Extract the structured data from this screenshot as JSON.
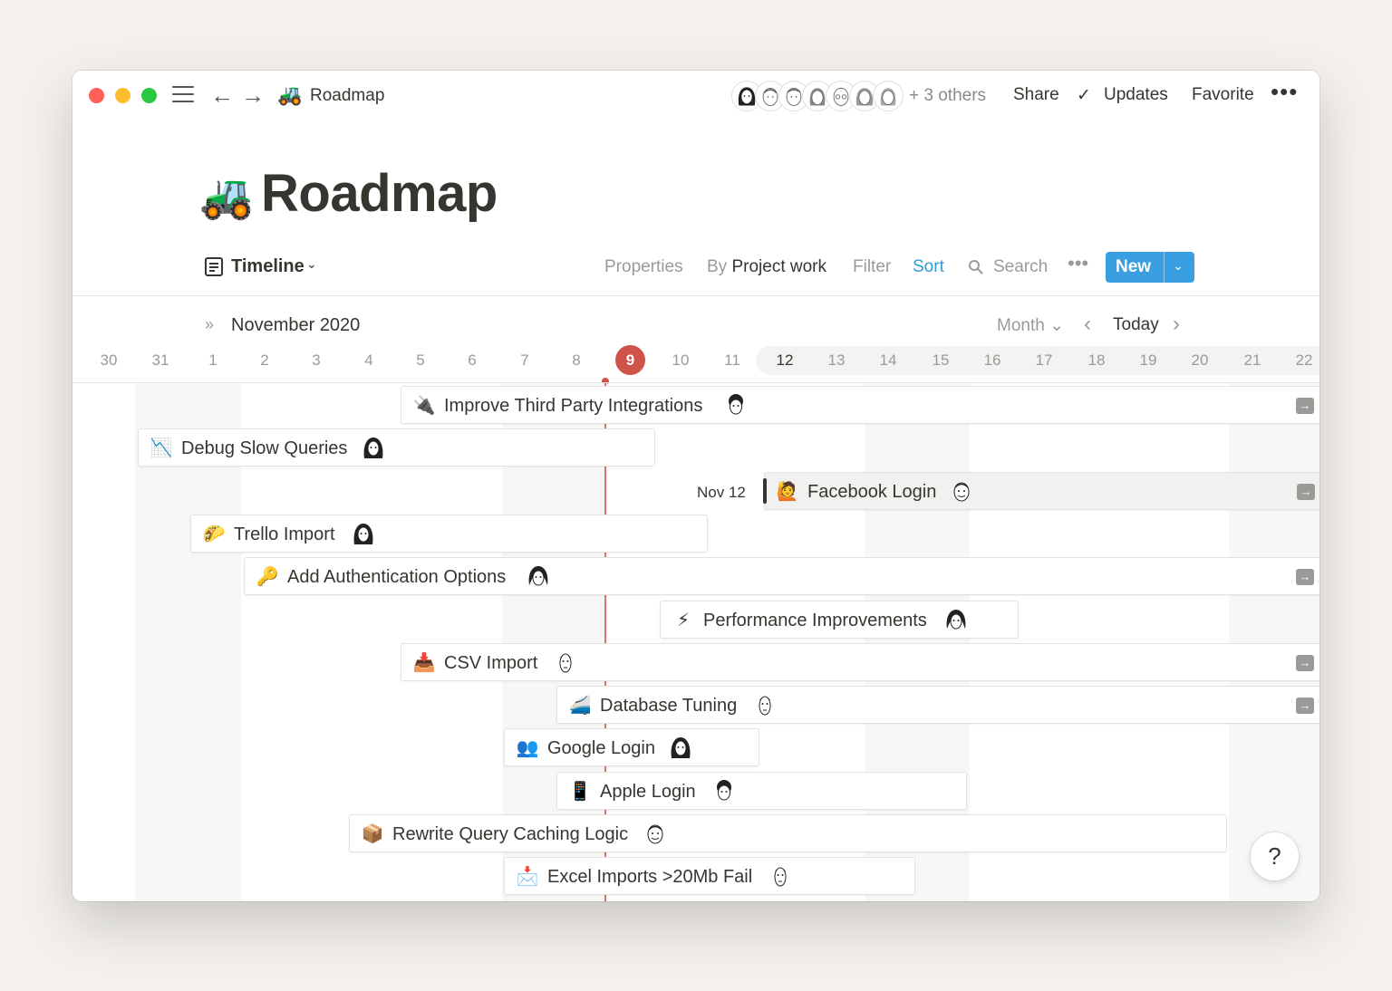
{
  "titlebar": {
    "breadcrumb_icon": "🚜",
    "breadcrumb_title": "Roadmap",
    "others_label": "+ 3 others",
    "share_label": "Share",
    "updates_label": "Updates",
    "favorite_label": "Favorite",
    "more_label": "•••"
  },
  "page": {
    "icon": "🚜",
    "title": "Roadmap"
  },
  "viewbar": {
    "view_name": "Timeline",
    "properties_label": "Properties",
    "by_label": "By",
    "group_label": "Project work",
    "filter_label": "Filter",
    "sort_label": "Sort",
    "search_label": "Search",
    "more_label": "•••",
    "new_label": "New"
  },
  "timeline": {
    "month_label": "November 2020",
    "scale_label": "Month",
    "today_label": "Today",
    "days": [
      "30",
      "31",
      "1",
      "2",
      "3",
      "4",
      "5",
      "6",
      "7",
      "8",
      "9",
      "10",
      "11",
      "12",
      "13",
      "14",
      "15",
      "16",
      "17",
      "18",
      "19",
      "20",
      "21",
      "22"
    ],
    "today_day": "9",
    "selected_date_label": "Nov 12",
    "accent_color": "#d0534a",
    "new_button_color": "#3a9fe0",
    "items": [
      {
        "icon": "🔌",
        "name": "Improve Third Party Integrations",
        "face": "curly-hair-face-icon",
        "extends": true
      },
      {
        "icon": "📉",
        "name": "Debug Slow Queries",
        "face": "long-hair-face-icon",
        "extends": false
      },
      {
        "icon": "🙋",
        "name": "Facebook Login",
        "face": "smiling-face-icon",
        "extends": true,
        "selected": true
      },
      {
        "icon": "🌮",
        "name": "Trello Import",
        "face": "long-hair-face-icon",
        "extends": false
      },
      {
        "icon": "🔑",
        "name": "Add Authentication Options",
        "face": "wavy-hair-face-icon",
        "extends": true
      },
      {
        "icon": "⚡",
        "name": "Performance Improvements",
        "face": "wavy-hair-face-icon",
        "extends": false
      },
      {
        "icon": "📥",
        "name": "CSV Import",
        "face": "tall-face-icon",
        "extends": true
      },
      {
        "icon": "🚄",
        "name": "Database Tuning",
        "face": "tall-face-icon",
        "extends": true
      },
      {
        "icon": "👥",
        "name": "Google Login",
        "face": "long-hair-face-icon",
        "extends": false
      },
      {
        "icon": "📱",
        "name": "Apple Login",
        "face": "curly-hair-face-icon",
        "extends": false
      },
      {
        "icon": "📦",
        "name": "Rewrite Query Caching Logic",
        "face": "smiling-face-icon",
        "extends": false
      },
      {
        "icon": "📩",
        "name": "Excel Imports >20Mb Fail",
        "face": "tall-face-icon",
        "extends": false
      }
    ]
  },
  "help": {
    "label": "?"
  }
}
